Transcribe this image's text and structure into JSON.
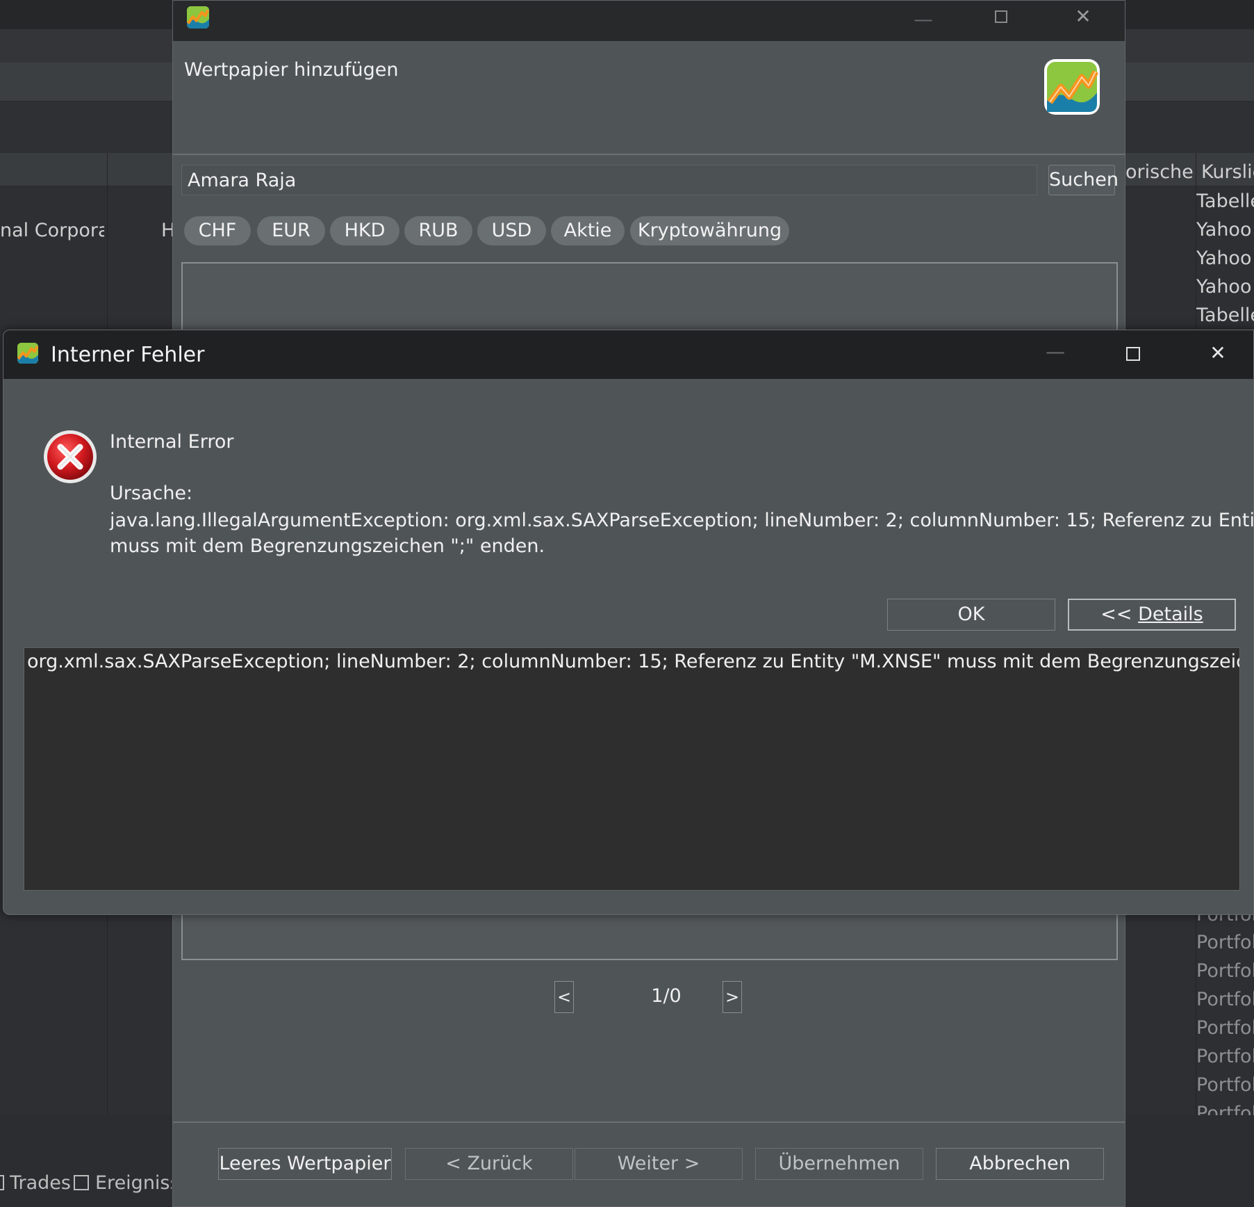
{
  "background": {
    "left_cells": [
      "nal Corpora...",
      "H"
    ],
    "column_headers": [
      "orischer",
      "Kurslie"
    ],
    "right_column_top": [
      "Tabelle",
      "Yahoo",
      "Yahoo",
      "Yahoo",
      "Tabelle"
    ],
    "right_column_bottom": [
      "Portfol",
      "Portfol",
      "Portfol",
      "Portfol",
      "Portfol",
      "Portfol",
      "Portfol",
      "Portfol"
    ],
    "status_items": [
      "Trades",
      "Ereignisse"
    ]
  },
  "add_security_dialog": {
    "heading": "Wertpapier hinzufügen",
    "search": {
      "value": "Amara Raja",
      "button_label": "Suchen"
    },
    "filter_chips": [
      "CHF",
      "EUR",
      "HKD",
      "RUB",
      "USD",
      "Aktie",
      "Kryptowährung"
    ],
    "pager": {
      "prev": "<",
      "text": "1/0",
      "next": ">"
    },
    "buttons": {
      "empty": "Leeres Wertpapier",
      "back": "< Zurück",
      "next": "Weiter >",
      "apply": "Übernehmen",
      "cancel": "Abbrechen"
    }
  },
  "error_dialog": {
    "title": "Interner Fehler",
    "headline": "Internal Error",
    "cause_label": "Ursache:",
    "cause_line1": "java.lang.IllegalArgumentException: org.xml.sax.SAXParseException; lineNumber: 2; columnNumber: 15; Referenz zu Entity \"M.XNSE\"",
    "cause_line2": "muss mit dem Begrenzungszeichen \";\" enden.",
    "ok_label": "OK",
    "details_prefix": "<< ",
    "details_label": "Details",
    "details_text": "org.xml.sax.SAXParseException; lineNumber: 2; columnNumber: 15; Referenz zu Entity \"M.XNSE\" muss mit dem Begrenzungszeichen \";\" enden."
  },
  "colors": {
    "dialog_bg": "#4f5457",
    "titlebar_bg": "#202122",
    "details_bg": "#2e2e2e",
    "error_red": "#c8151b"
  }
}
